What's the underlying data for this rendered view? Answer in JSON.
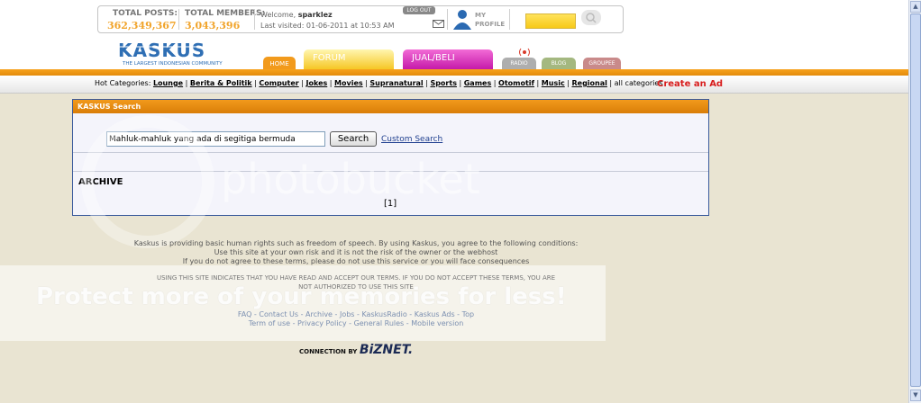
{
  "stats": {
    "total_posts_label": "TOTAL POSTS:",
    "total_posts_value": "362,349,367",
    "total_members_label": "TOTAL MEMBERS:",
    "total_members_value": "3,043,396"
  },
  "user": {
    "welcome_prefix": "Welcome,",
    "username": "sparklez",
    "last_visited": "Last visited: 01-06-2011 at 10:53 AM",
    "logout_label": "LOG OUT",
    "profile_label_1": "MY",
    "profile_label_2": "PROFILE"
  },
  "logo": {
    "text": "KASKUS",
    "tagline": "THE LARGEST INDONESIAN COMMUNITY"
  },
  "tabs": [
    {
      "label": "HOME"
    },
    {
      "label": "FORUM"
    },
    {
      "label": "JUAL/BELI"
    },
    {
      "label": "RADIO"
    },
    {
      "label": "BLOG"
    },
    {
      "label": "GROUPEE"
    }
  ],
  "categories": {
    "prefix": "Hot Categories:",
    "items": [
      "Lounge",
      "Berita & Politik",
      "Computer",
      "Jokes",
      "Movies",
      "Supranatural",
      "Sports",
      "Games",
      "Otomotif",
      "Music",
      "Regional"
    ],
    "all_label": "all categories"
  },
  "create_ad_label": "Create an Ad",
  "search_panel": {
    "title": "KASKUS Search",
    "query": "Mahluk-mahluk yang ada di segitiga bermuda",
    "search_button": "Search",
    "custom_search_link": "Custom Search",
    "archive_label": "ARCHIVE",
    "pager": "[1]"
  },
  "disclaimer": {
    "line1": "Kaskus is providing basic human rights such as freedom of speech. By using Kaskus, you agree to the following conditions:",
    "line2": "Use this site at your own risk and it is not the risk of the owner or the webhost",
    "line3": "If you do not agree to these terms, please do not use this service or you will face consequences",
    "terms1": "USING THIS SITE INDICATES THAT YOU HAVE READ AND ACCEPT OUR TERMS. IF YOU DO NOT ACCEPT THESE TERMS, YOU ARE",
    "terms2": "NOT AUTHORIZED TO USE THIS SITE"
  },
  "footer": {
    "links_row1": [
      "FAQ",
      "Contact Us",
      "Archive",
      "Jobs",
      "KaskusRadio",
      "Kaskus Ads",
      "Top"
    ],
    "links_row2": [
      "Term of use",
      "Privacy Policy",
      "General Rules",
      "Mobile version"
    ],
    "connection_prefix": "CONNECTION BY",
    "connection_brand": "BiZNET."
  },
  "watermarks": {
    "photobucket": "photobucket",
    "protect": "Protect more of your memories for less!"
  },
  "colors": {
    "accent_orange": "#f29a1c",
    "stat_value": "#f1a42b",
    "create_ad": "#d81d1d",
    "panel_border": "#3a5a9c"
  }
}
